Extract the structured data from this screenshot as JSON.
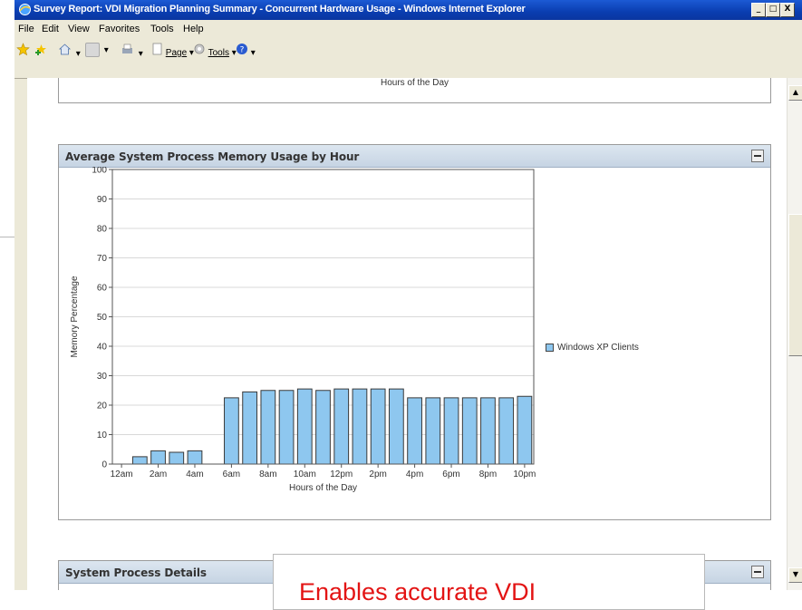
{
  "window": {
    "title": "Survey Report: VDI Migration Planning Summary - Concurrent Hardware Usage - Windows Internet Explorer",
    "buttons": {
      "minimize": "_",
      "maximize": "□",
      "close": "X"
    }
  },
  "menu": [
    "File",
    "Edit",
    "View",
    "Favorites",
    "Tools",
    "Help"
  ],
  "toolbar": {
    "page_label": "Page",
    "tools_label": "Tools"
  },
  "previous_panel": {
    "axis_label": "Hours of the Day"
  },
  "panel": {
    "title": "Average System Process Memory Usage by Hour"
  },
  "chart_data": {
    "type": "bar",
    "title": "Average System Process Memory Usage by Hour",
    "xlabel": "Hours of the Day",
    "ylabel": "Memory Percentage",
    "ylim": [
      0,
      100
    ],
    "yticks": [
      0,
      10,
      20,
      30,
      40,
      50,
      60,
      70,
      80,
      90,
      100
    ],
    "categories": [
      "12am",
      "1am",
      "2am",
      "3am",
      "4am",
      "5am",
      "6am",
      "7am",
      "8am",
      "9am",
      "10am",
      "11am",
      "12pm",
      "1pm",
      "2pm",
      "3pm",
      "4pm",
      "5pm",
      "6pm",
      "7pm",
      "8pm",
      "9pm",
      "10pm"
    ],
    "tick_labels": [
      "12am",
      "2am",
      "4am",
      "6am",
      "8am",
      "10am",
      "12pm",
      "2pm",
      "4pm",
      "6pm",
      "8pm",
      "10pm"
    ],
    "series": [
      {
        "name": "Windows XP Clients",
        "color": "#8ec7ef",
        "values": [
          0,
          2.5,
          4.5,
          4,
          4.5,
          null,
          22.5,
          24.5,
          25,
          25,
          25.5,
          25,
          25.5,
          25.5,
          25.5,
          25.5,
          22.5,
          22.5,
          22.5,
          22.5,
          22.5,
          22.5,
          23
        ]
      }
    ],
    "grid": true,
    "legend_position": "right"
  },
  "panel2": {
    "title": "System Process Details"
  },
  "callout": {
    "text": "Enables accurate VDI"
  }
}
